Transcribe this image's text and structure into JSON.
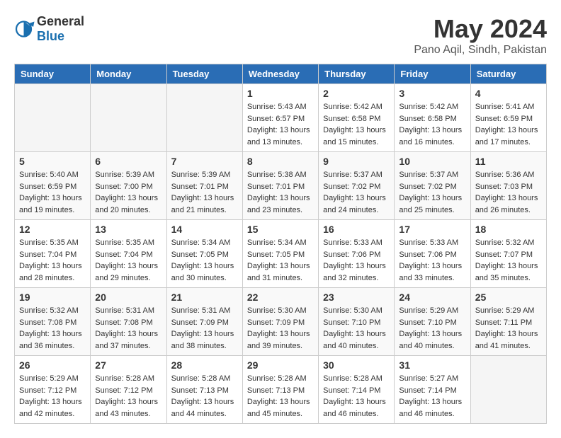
{
  "app": {
    "logo_general": "General",
    "logo_blue": "Blue"
  },
  "header": {
    "month": "May 2024",
    "location": "Pano Aqil, Sindh, Pakistan"
  },
  "weekdays": [
    "Sunday",
    "Monday",
    "Tuesday",
    "Wednesday",
    "Thursday",
    "Friday",
    "Saturday"
  ],
  "weeks": [
    [
      {
        "day": "",
        "empty": true
      },
      {
        "day": "",
        "empty": true
      },
      {
        "day": "",
        "empty": true
      },
      {
        "day": "1",
        "sunrise": "5:43 AM",
        "sunset": "6:57 PM",
        "daylight": "13 hours and 13 minutes."
      },
      {
        "day": "2",
        "sunrise": "5:42 AM",
        "sunset": "6:58 PM",
        "daylight": "13 hours and 15 minutes."
      },
      {
        "day": "3",
        "sunrise": "5:42 AM",
        "sunset": "6:58 PM",
        "daylight": "13 hours and 16 minutes."
      },
      {
        "day": "4",
        "sunrise": "5:41 AM",
        "sunset": "6:59 PM",
        "daylight": "13 hours and 17 minutes."
      }
    ],
    [
      {
        "day": "5",
        "sunrise": "5:40 AM",
        "sunset": "6:59 PM",
        "daylight": "13 hours and 19 minutes."
      },
      {
        "day": "6",
        "sunrise": "5:39 AM",
        "sunset": "7:00 PM",
        "daylight": "13 hours and 20 minutes."
      },
      {
        "day": "7",
        "sunrise": "5:39 AM",
        "sunset": "7:01 PM",
        "daylight": "13 hours and 21 minutes."
      },
      {
        "day": "8",
        "sunrise": "5:38 AM",
        "sunset": "7:01 PM",
        "daylight": "13 hours and 23 minutes."
      },
      {
        "day": "9",
        "sunrise": "5:37 AM",
        "sunset": "7:02 PM",
        "daylight": "13 hours and 24 minutes."
      },
      {
        "day": "10",
        "sunrise": "5:37 AM",
        "sunset": "7:02 PM",
        "daylight": "13 hours and 25 minutes."
      },
      {
        "day": "11",
        "sunrise": "5:36 AM",
        "sunset": "7:03 PM",
        "daylight": "13 hours and 26 minutes."
      }
    ],
    [
      {
        "day": "12",
        "sunrise": "5:35 AM",
        "sunset": "7:04 PM",
        "daylight": "13 hours and 28 minutes."
      },
      {
        "day": "13",
        "sunrise": "5:35 AM",
        "sunset": "7:04 PM",
        "daylight": "13 hours and 29 minutes."
      },
      {
        "day": "14",
        "sunrise": "5:34 AM",
        "sunset": "7:05 PM",
        "daylight": "13 hours and 30 minutes."
      },
      {
        "day": "15",
        "sunrise": "5:34 AM",
        "sunset": "7:05 PM",
        "daylight": "13 hours and 31 minutes."
      },
      {
        "day": "16",
        "sunrise": "5:33 AM",
        "sunset": "7:06 PM",
        "daylight": "13 hours and 32 minutes."
      },
      {
        "day": "17",
        "sunrise": "5:33 AM",
        "sunset": "7:06 PM",
        "daylight": "13 hours and 33 minutes."
      },
      {
        "day": "18",
        "sunrise": "5:32 AM",
        "sunset": "7:07 PM",
        "daylight": "13 hours and 35 minutes."
      }
    ],
    [
      {
        "day": "19",
        "sunrise": "5:32 AM",
        "sunset": "7:08 PM",
        "daylight": "13 hours and 36 minutes."
      },
      {
        "day": "20",
        "sunrise": "5:31 AM",
        "sunset": "7:08 PM",
        "daylight": "13 hours and 37 minutes."
      },
      {
        "day": "21",
        "sunrise": "5:31 AM",
        "sunset": "7:09 PM",
        "daylight": "13 hours and 38 minutes."
      },
      {
        "day": "22",
        "sunrise": "5:30 AM",
        "sunset": "7:09 PM",
        "daylight": "13 hours and 39 minutes."
      },
      {
        "day": "23",
        "sunrise": "5:30 AM",
        "sunset": "7:10 PM",
        "daylight": "13 hours and 40 minutes."
      },
      {
        "day": "24",
        "sunrise": "5:29 AM",
        "sunset": "7:10 PM",
        "daylight": "13 hours and 40 minutes."
      },
      {
        "day": "25",
        "sunrise": "5:29 AM",
        "sunset": "7:11 PM",
        "daylight": "13 hours and 41 minutes."
      }
    ],
    [
      {
        "day": "26",
        "sunrise": "5:29 AM",
        "sunset": "7:12 PM",
        "daylight": "13 hours and 42 minutes."
      },
      {
        "day": "27",
        "sunrise": "5:28 AM",
        "sunset": "7:12 PM",
        "daylight": "13 hours and 43 minutes."
      },
      {
        "day": "28",
        "sunrise": "5:28 AM",
        "sunset": "7:13 PM",
        "daylight": "13 hours and 44 minutes."
      },
      {
        "day": "29",
        "sunrise": "5:28 AM",
        "sunset": "7:13 PM",
        "daylight": "13 hours and 45 minutes."
      },
      {
        "day": "30",
        "sunrise": "5:28 AM",
        "sunset": "7:14 PM",
        "daylight": "13 hours and 46 minutes."
      },
      {
        "day": "31",
        "sunrise": "5:27 AM",
        "sunset": "7:14 PM",
        "daylight": "13 hours and 46 minutes."
      },
      {
        "day": "",
        "empty": true
      }
    ]
  ]
}
